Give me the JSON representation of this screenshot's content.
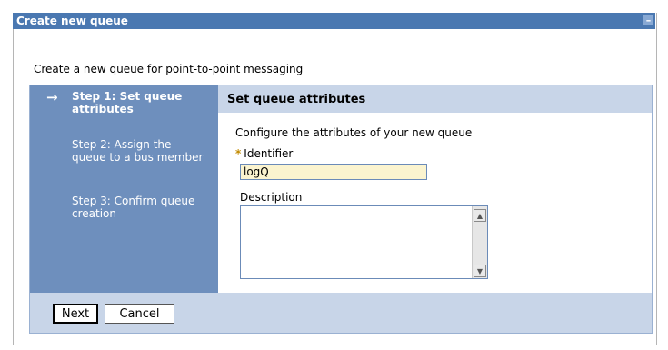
{
  "window": {
    "title": "Create new queue",
    "minimize_glyph": "–"
  },
  "intro": "Create a new queue for point-to-point messaging",
  "steps": [
    {
      "label": "Step 1: Set queue attributes",
      "active": true,
      "marker": "→"
    },
    {
      "label": "Step 2: Assign the queue to a bus member",
      "active": false
    },
    {
      "label": "Step 3: Confirm queue creation",
      "active": false
    }
  ],
  "panel": {
    "title": "Set queue attributes",
    "instructions": "Configure the attributes of your new queue",
    "identifier": {
      "required_marker": "*",
      "label": "Identifier",
      "value": "logQ"
    },
    "description": {
      "label": "Description",
      "value": ""
    }
  },
  "buttons": {
    "next": "Next",
    "cancel": "Cancel"
  },
  "colors": {
    "titlebar": "#4a78b1",
    "sidebar": "#6e8fbd",
    "header": "#c8d5e8",
    "input_bg": "#fbf4cf",
    "required": "#c28a00"
  }
}
